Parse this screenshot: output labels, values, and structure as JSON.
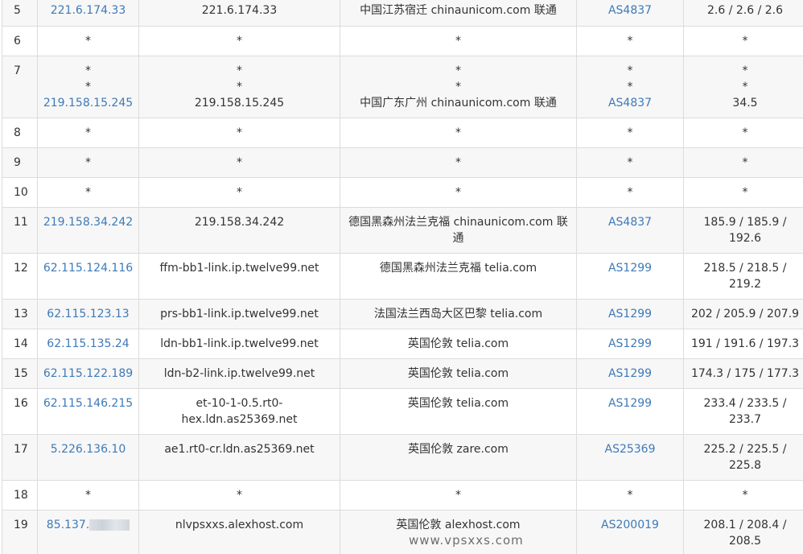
{
  "rows": [
    {
      "hop": "5",
      "ip": "221.6.174.33",
      "host": "221.6.174.33",
      "geo": "中国江苏宿迁 chinaunicom.com 联通",
      "as": "AS4837",
      "rtt": "2.6 / 2.6 / 2.6"
    },
    {
      "hop": "6",
      "ip": "*",
      "host": "*",
      "geo": "*",
      "as": "*",
      "rtt": "*"
    },
    {
      "hop": "7",
      "ip": "*\n*\n219.158.15.245",
      "host": "*\n*\n219.158.15.245",
      "geo": "*\n*\n中国广东广州 chinaunicom.com 联通",
      "as": "*\n*\nAS4837",
      "rtt": "*\n*\n34.5"
    },
    {
      "hop": "8",
      "ip": "*",
      "host": "*",
      "geo": "*",
      "as": "*",
      "rtt": "*"
    },
    {
      "hop": "9",
      "ip": "*",
      "host": "*",
      "geo": "*",
      "as": "*",
      "rtt": "*"
    },
    {
      "hop": "10",
      "ip": "*",
      "host": "*",
      "geo": "*",
      "as": "*",
      "rtt": "*"
    },
    {
      "hop": "11",
      "ip": "219.158.34.242",
      "host": "219.158.34.242",
      "geo": "德国黑森州法兰克福 chinaunicom.com 联\n通",
      "as": "AS4837",
      "rtt": "185.9 / 185.9 /\n192.6"
    },
    {
      "hop": "12",
      "ip": "62.115.124.116",
      "host": "ffm-bb1-link.ip.twelve99.net",
      "geo": "德国黑森州法兰克福 telia.com",
      "as": "AS1299",
      "rtt": "218.5 / 218.5 /\n219.2"
    },
    {
      "hop": "13",
      "ip": "62.115.123.13",
      "host": "prs-bb1-link.ip.twelve99.net",
      "geo": "法国法兰西岛大区巴黎 telia.com",
      "as": "AS1299",
      "rtt": "202 / 205.9 / 207.9"
    },
    {
      "hop": "14",
      "ip": "62.115.135.24",
      "host": "ldn-bb1-link.ip.twelve99.net",
      "geo": "英国伦敦 telia.com",
      "as": "AS1299",
      "rtt": "191 / 191.6 / 197.3"
    },
    {
      "hop": "15",
      "ip": "62.115.122.189",
      "host": "ldn-b2-link.ip.twelve99.net",
      "geo": "英国伦敦 telia.com",
      "as": "AS1299",
      "rtt": "174.3 / 175 / 177.3"
    },
    {
      "hop": "16",
      "ip": "62.115.146.215",
      "host": "et-10-1-0.5.rt0-\nhex.ldn.as25369.net",
      "geo": "英国伦敦 telia.com",
      "as": "AS1299",
      "rtt": "233.4 / 233.5 /\n233.7"
    },
    {
      "hop": "17",
      "ip": "5.226.136.10",
      "host": "ae1.rt0-cr.ldn.as25369.net",
      "geo": "英国伦敦 zare.com",
      "as": "AS25369",
      "rtt": "225.2 / 225.5 /\n225.8"
    },
    {
      "hop": "18",
      "ip": "*",
      "host": "*",
      "geo": "*",
      "as": "*",
      "rtt": "*"
    },
    {
      "hop": "19",
      "ip": "85.137.",
      "host": "nlvpsxxs.alexhost.com",
      "geo": "英国伦敦 alexhost.com",
      "as": "AS200019",
      "rtt": "208.1 / 208.4 /\n208.5"
    }
  ],
  "watermark": "www.vpsxxs.com"
}
